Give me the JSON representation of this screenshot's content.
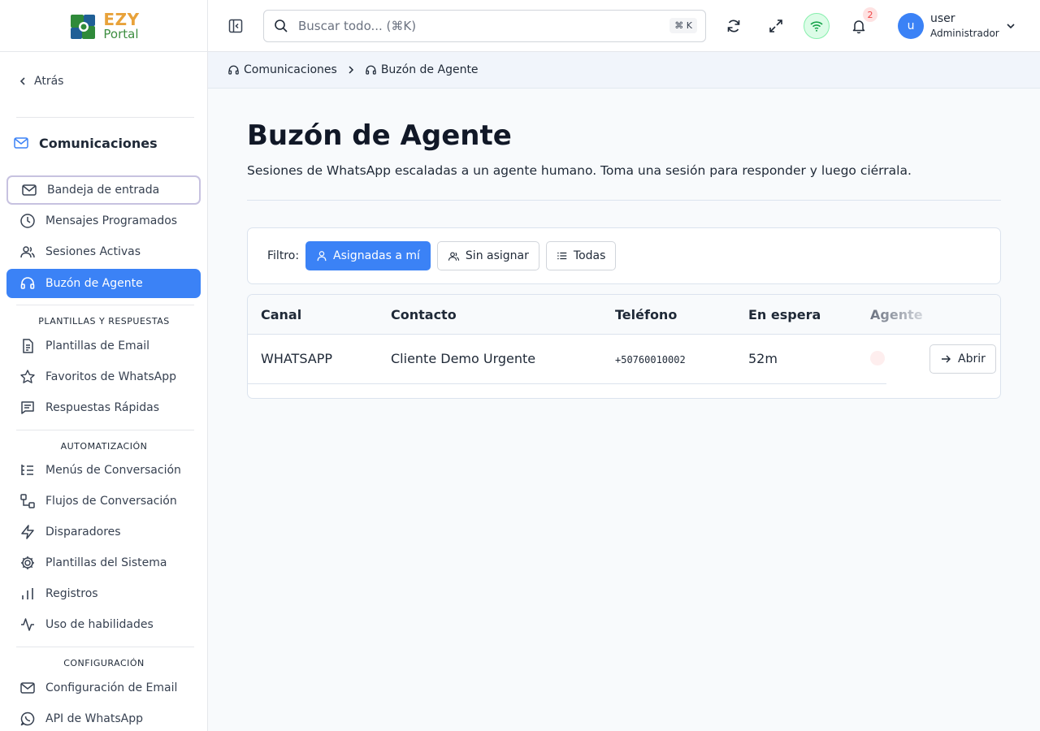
{
  "brand": {
    "line1": "EZY",
    "line2": "Portal"
  },
  "sidebar": {
    "back_label": "Atrás",
    "section_title": "Comunicaciones",
    "items": [
      {
        "label": "Bandeja de entrada"
      },
      {
        "label": "Mensajes Programados"
      },
      {
        "label": "Sesiones Activas"
      },
      {
        "label": "Buzón de Agente"
      }
    ],
    "groups": [
      {
        "label": "PLANTILLAS Y RESPUESTAS",
        "items": [
          {
            "label": "Plantillas de Email"
          },
          {
            "label": "Favoritos de WhatsApp"
          },
          {
            "label": "Respuestas Rápidas"
          }
        ]
      },
      {
        "label": "AUTOMATIZACIÓN",
        "items": [
          {
            "label": "Menús de Conversación"
          },
          {
            "label": "Flujos de Conversación"
          },
          {
            "label": "Disparadores"
          },
          {
            "label": "Plantillas del Sistema"
          },
          {
            "label": "Registros"
          },
          {
            "label": "Uso de habilidades"
          }
        ]
      },
      {
        "label": "CONFIGURACIÓN",
        "items": [
          {
            "label": "Configuración de Email"
          },
          {
            "label": "API de WhatsApp"
          }
        ]
      }
    ]
  },
  "header": {
    "search_placeholder": "Buscar todo... (⌘K)",
    "search_shortcut": "⌘ K",
    "notifications_count": "2",
    "user": {
      "initial": "u",
      "name": "user",
      "role": "Administrador"
    }
  },
  "breadcrumb": {
    "parent": "Comunicaciones",
    "current": "Buzón de Agente"
  },
  "page": {
    "title": "Buzón de Agente",
    "subtitle": "Sesiones de WhatsApp escaladas a un agente humano. Toma una sesión para responder y luego ciérrala."
  },
  "filter": {
    "label": "Filtro:",
    "options": [
      {
        "label": "Asignadas a mí",
        "selected": true
      },
      {
        "label": "Sin asignar",
        "selected": false
      },
      {
        "label": "Todas",
        "selected": false
      }
    ]
  },
  "table": {
    "columns": [
      "Canal",
      "Contacto",
      "Teléfono",
      "En espera",
      "Agente"
    ],
    "rows": [
      {
        "canal": "WHATSAPP",
        "contacto": "Cliente Demo Urgente",
        "telefono": "+50760010002",
        "espera": "52m",
        "action": "Abrir"
      }
    ]
  },
  "colors": {
    "accent": "#3b82f6",
    "brand_orange": "#e8a23a",
    "brand_green": "#3e8e41"
  }
}
